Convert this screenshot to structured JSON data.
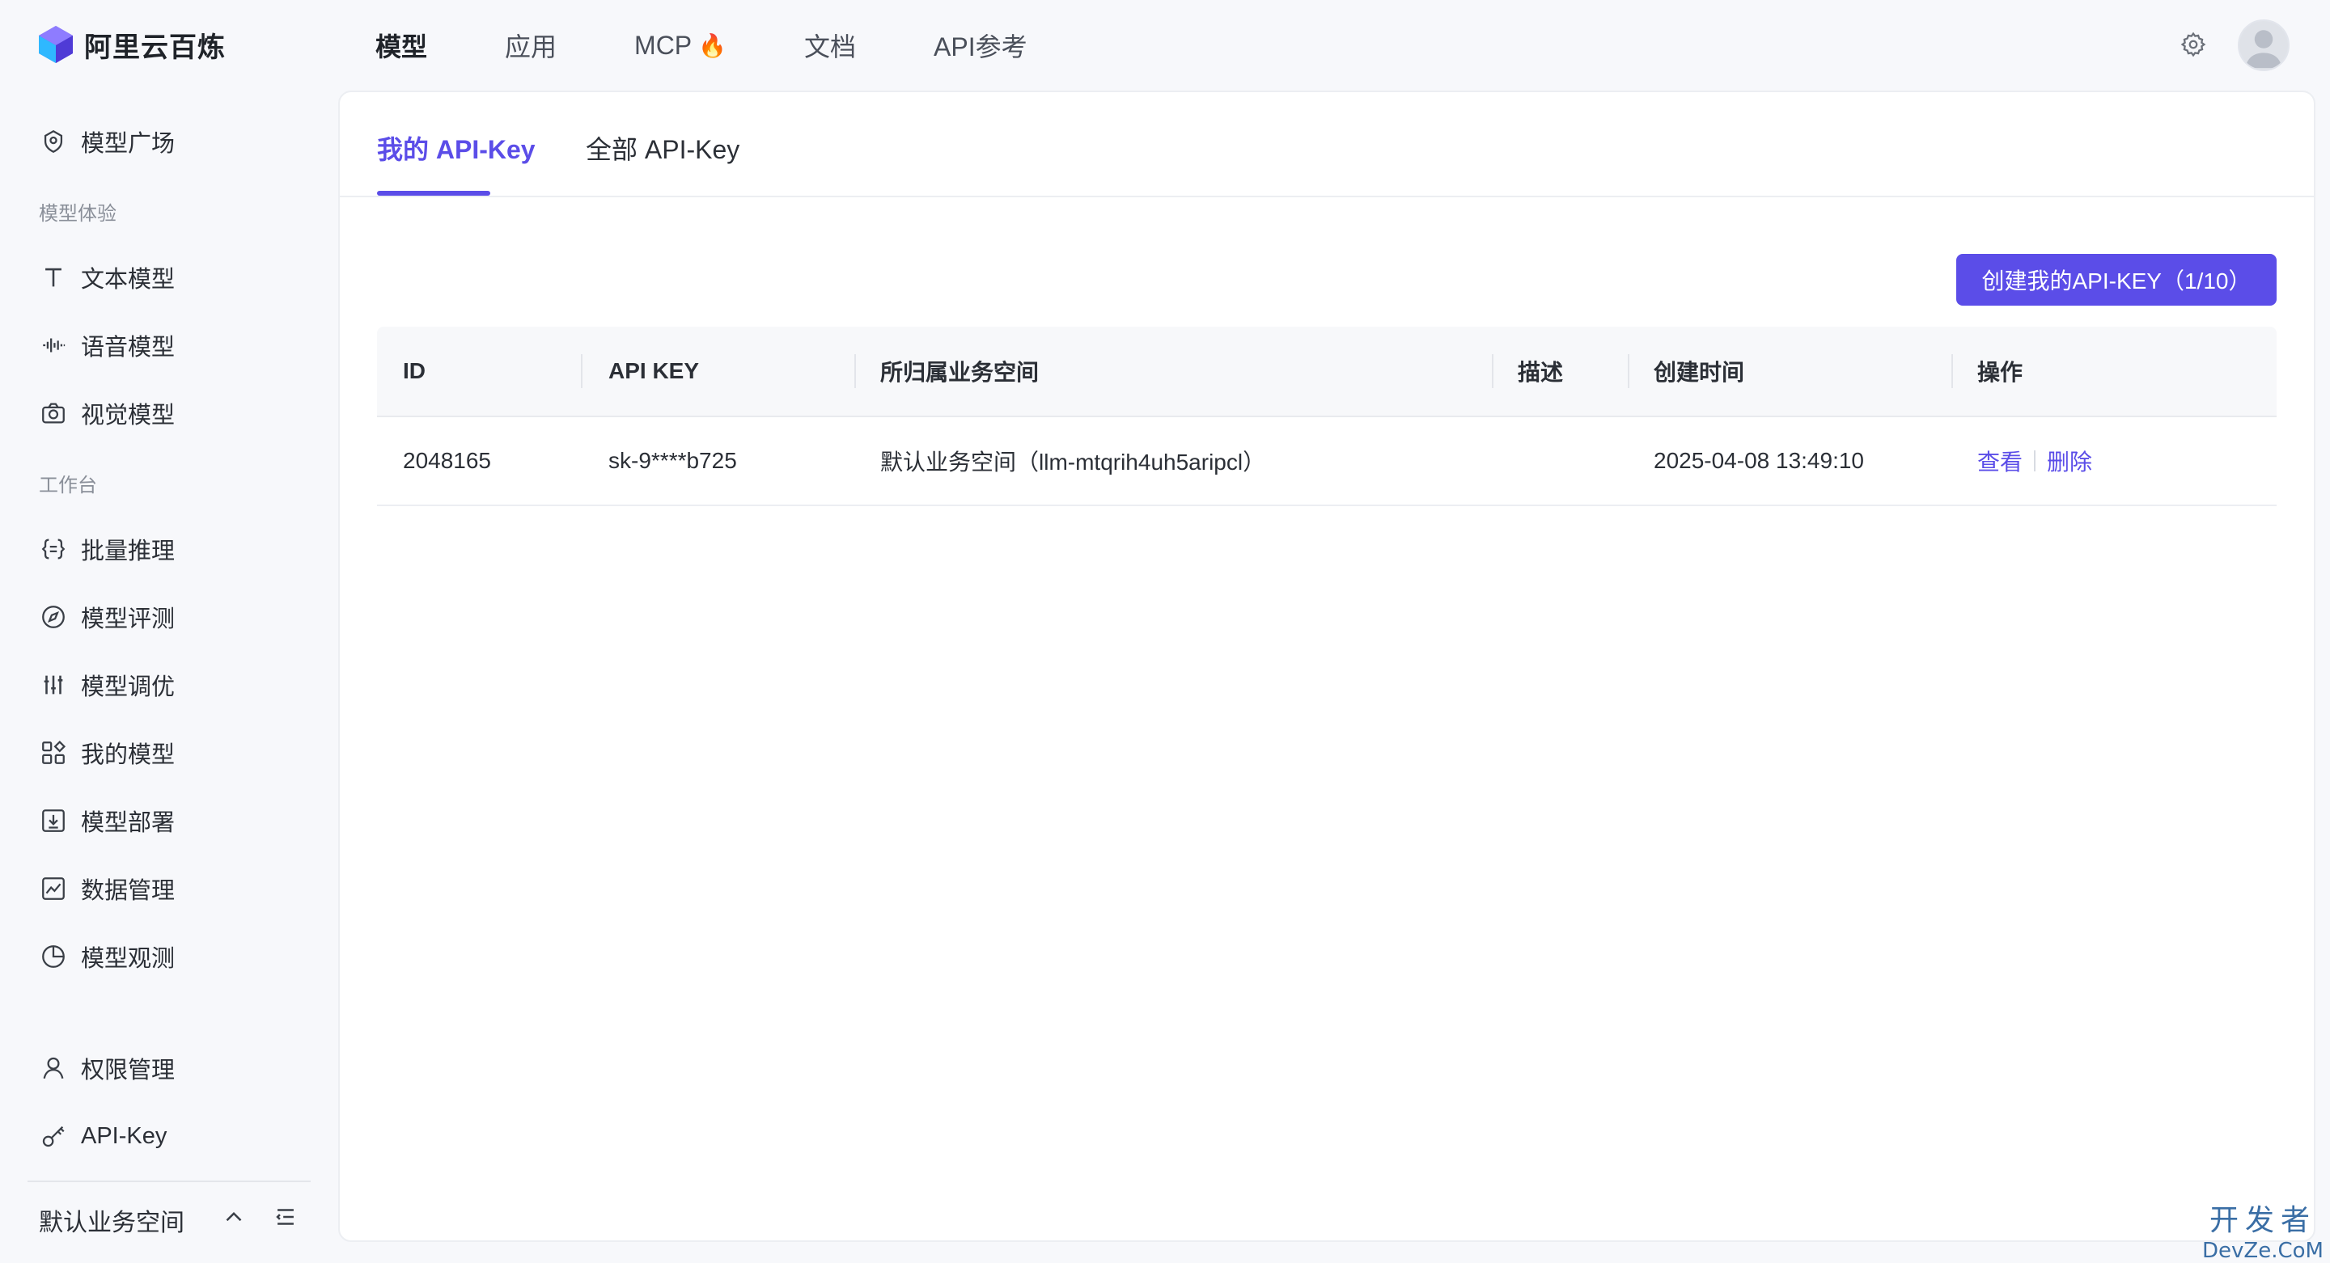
{
  "brand": {
    "name": "阿里云百炼"
  },
  "nav": {
    "items": [
      {
        "label": "模型"
      },
      {
        "label": "应用"
      },
      {
        "label": "MCP"
      },
      {
        "label": "文档"
      },
      {
        "label": "API参考"
      }
    ],
    "active": "模型"
  },
  "sidebar": {
    "items": [
      {
        "label": "模型广场",
        "icon": "model-square-icon"
      },
      {
        "label": "文本模型",
        "icon": "text-icon"
      },
      {
        "label": "语音模型",
        "icon": "audio-wave-icon"
      },
      {
        "label": "视觉模型",
        "icon": "camera-icon"
      },
      {
        "label": "批量推理",
        "icon": "braces-icon"
      },
      {
        "label": "模型评测",
        "icon": "compass-icon"
      },
      {
        "label": "模型调优",
        "icon": "sliders-icon"
      },
      {
        "label": "我的模型",
        "icon": "apps-icon"
      },
      {
        "label": "模型部署",
        "icon": "download-box-icon"
      },
      {
        "label": "数据管理",
        "icon": "chart-box-icon"
      },
      {
        "label": "模型观测",
        "icon": "pie-icon"
      },
      {
        "label": "权限管理",
        "icon": "user-icon"
      },
      {
        "label": "API-Key",
        "icon": "key-icon"
      }
    ],
    "sections": {
      "experience": "模型体验",
      "workbench": "工作台"
    },
    "workspace": "默认业务空间"
  },
  "tabs": [
    {
      "label": "我的 API-Key"
    },
    {
      "label": "全部 API-Key"
    }
  ],
  "create_button": "创建我的API-KEY（1/10）",
  "table": {
    "headers": [
      "ID",
      "API KEY",
      "所归属业务空间",
      "描述",
      "创建时间",
      "操作"
    ],
    "rows": [
      {
        "id": "2048165",
        "api_key": "sk-9****b725",
        "workspace": "默认业务空间（llm-mtqrih4uh5aripcl）",
        "description": "",
        "created": "2025-04-08 13:49:10",
        "actions": {
          "view": "查看",
          "delete": "删除"
        }
      }
    ]
  },
  "watermark": {
    "line1": "开发者",
    "line2": "DevZe.CoM"
  },
  "colors": {
    "accent": "#5b4de8",
    "fire": "#ff7a1a"
  }
}
